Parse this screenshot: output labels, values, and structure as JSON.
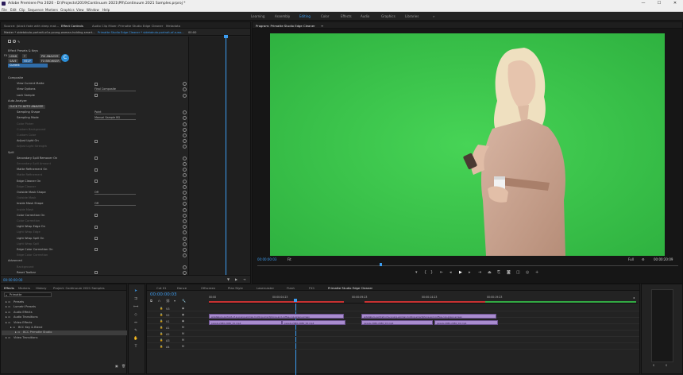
{
  "titlebar": {
    "title": "Adobe Premiere Pro 2020 - D:\\Projects\\2019\\Continuum 2021\\PR\\Continuum 2021 Samples.prproj *",
    "minimize": "—",
    "maximize": "☐",
    "close": "✕"
  },
  "menu": [
    "File",
    "Edit",
    "Clip",
    "Sequence",
    "Markers",
    "Graphics",
    "View",
    "Window",
    "Help"
  ],
  "workspaces": [
    "Learning",
    "Assembly",
    "Editing",
    "Color",
    "Effects",
    "Audio",
    "Graphics",
    "Libraries"
  ],
  "active_workspace": "Editing",
  "more_symbol": "»",
  "source_panel": {
    "tabs": [
      "Source: (black fade with deep mat...",
      "Effect Controls",
      "Audio Clip Mixer: Primatte Studio Edge Cleaner",
      "Metadata"
    ],
    "breadcrumb": "Master * sidetabulo-portrait-of-a-young-woman-holding-smart...",
    "sequence_ref": "Primatte Studio Edge Cleaner * sidetabulo-portrait-of-a-wo...",
    "ruler_start": "00:00",
    "effect_name": "Primatte Studio Edge Cleaner",
    "badge": "C",
    "preset_buttons": [
      "LOAD",
      "?",
      "SAVE",
      "HELP",
      "PIX ANALYZE",
      "FX BROWSER"
    ],
    "fx_button": "FX",
    "current_label": "Current",
    "rows": [
      {
        "label": "Composite",
        "kind": "section"
      },
      {
        "label": "View Current Matte",
        "kind": "check"
      },
      {
        "label": "View Options",
        "kind": "dropdown",
        "value": "Final Composite"
      },
      {
        "label": "Lock Sample",
        "kind": "check"
      },
      {
        "label": "Auto Analyze",
        "kind": "section"
      },
      {
        "label": "CLICK TO AUTO ANALYZE",
        "kind": "button"
      },
      {
        "label": "Sampling Shape",
        "kind": "dropdown",
        "value": "Point"
      },
      {
        "label": "Sampling Mode",
        "kind": "dropdown",
        "value": "Manual Sample BG"
      },
      {
        "label": "Color Picker",
        "kind": "dim"
      },
      {
        "label": "Custom Background",
        "kind": "dim"
      },
      {
        "label": "Custom Color",
        "kind": "dim"
      },
      {
        "label": "Adjust Light On",
        "kind": "check"
      },
      {
        "label": "Adjust Light Strength",
        "kind": "dim"
      },
      {
        "label": "Spill",
        "kind": "section"
      },
      {
        "label": "Secondary Spill Remover On",
        "kind": "check"
      },
      {
        "label": "Secondary Spill Amount",
        "kind": "dim"
      },
      {
        "label": "Matte Refinement On",
        "kind": "check"
      },
      {
        "label": "Matte Refinement",
        "kind": "dim"
      },
      {
        "label": "Edge Cleaner On",
        "kind": "check"
      },
      {
        "label": "Edge Cleaner",
        "kind": "dim"
      },
      {
        "label": "Outside Mask Shape",
        "kind": "dropdown",
        "value": "Off"
      },
      {
        "label": "Outside Mask",
        "kind": "dim"
      },
      {
        "label": "Inside Mask Shape",
        "kind": "dropdown",
        "value": "Off"
      },
      {
        "label": "Inside Mask",
        "kind": "dim"
      },
      {
        "label": "Color Correction On",
        "kind": "check"
      },
      {
        "label": "Color Correction",
        "kind": "dim"
      },
      {
        "label": "Light Wrap Edge On",
        "kind": "check"
      },
      {
        "label": "Light Wrap Edge",
        "kind": "dim"
      },
      {
        "label": "Light Wrap Spill On",
        "kind": "check"
      },
      {
        "label": "Light Wrap Spill",
        "kind": "dim"
      },
      {
        "label": "Edge Color Correction On",
        "kind": "check"
      },
      {
        "label": "Edge Color Correction",
        "kind": "dim"
      },
      {
        "label": "Advanced",
        "kind": "section"
      },
      {
        "label": "Background",
        "kind": "dim"
      },
      {
        "label": "Reset Toolbar",
        "kind": "check"
      }
    ],
    "bottom_timecode": "00:00:00:00"
  },
  "program": {
    "title": "Program: Primatte Studio Edge Cleaner",
    "menu_icon": "≡",
    "timecode": "00:00:00:03",
    "fit": "Fit",
    "quality": "Full",
    "duration": "00:00:20:09",
    "bg_color": "#3ec94e"
  },
  "project": {
    "tabs": [
      "Effects",
      "Markers",
      "History",
      "Project: Continuum 2021 Samples"
    ],
    "search_value": "Primatte",
    "items": [
      {
        "label": "Presets",
        "indent": 0
      },
      {
        "label": "Lumetri Presets",
        "indent": 0
      },
      {
        "label": "Audio Effects",
        "indent": 0
      },
      {
        "label": "Audio Transitions",
        "indent": 0
      },
      {
        "label": "Video Effects",
        "indent": 0
      },
      {
        "label": "BCC Key & Blend",
        "indent": 1
      },
      {
        "label": "BCC Primatte Studio",
        "indent": 2,
        "selected": true
      },
      {
        "label": "Video Transitions",
        "indent": 0
      }
    ]
  },
  "timeline": {
    "tabs": [
      "Cut 01",
      "Dance",
      "Offscreen",
      "Plan Style",
      "Lasercaster",
      "Flash",
      "FX1",
      "Primatte Studio Edge Cleaner"
    ],
    "active_tab": "Primatte Studio Edge Cleaner",
    "timecode": "00:00:00:03",
    "ruler": [
      "00:00",
      "00:00:04:23",
      "00:00:09:23",
      "00:00:14:23",
      "00:00:19:23"
    ],
    "tracks": [
      {
        "name": "V3"
      },
      {
        "name": "V2"
      },
      {
        "name": "V1"
      },
      {
        "name": "A1"
      },
      {
        "name": "A2"
      },
      {
        "name": "A3"
      },
      {
        "name": "A4"
      }
    ],
    "clips": [
      {
        "name": "sidetabulo-portrait-of-a-young-woman-holding-smartphone-and-coffee-cup-green-screen"
      },
      {
        "name": "sidetabulo-portrait-of-a-young-woman-holding-smartphone-and-coffee-cup-green-screen"
      },
      {
        "name": "pexels-2080-2080_01.mp4"
      },
      {
        "name": "pexels-2080-2080_02.mp4"
      },
      {
        "name": "pexels-2080-2080_03.mp4"
      },
      {
        "name": "pexels-2080-2080_04.mp4"
      }
    ]
  }
}
